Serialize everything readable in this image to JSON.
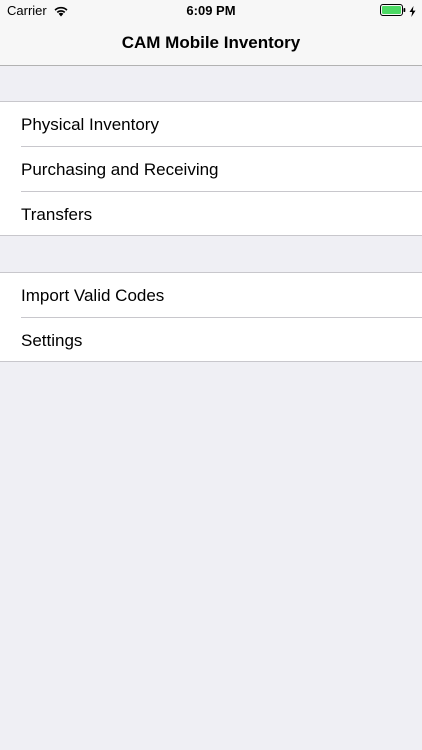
{
  "status_bar": {
    "carrier": "Carrier",
    "time": "6:09 PM",
    "wifi_icon": "wifi-icon",
    "battery_icon": "battery-full-icon",
    "charging_icon": "lightning-bolt-icon",
    "battery_color": "#4cd964"
  },
  "nav": {
    "title": "CAM Mobile Inventory"
  },
  "menu": {
    "section1": [
      {
        "label": "Physical Inventory"
      },
      {
        "label": "Purchasing and Receiving"
      },
      {
        "label": "Transfers"
      }
    ],
    "section2": [
      {
        "label": "Import Valid Codes"
      },
      {
        "label": "Settings"
      }
    ]
  }
}
